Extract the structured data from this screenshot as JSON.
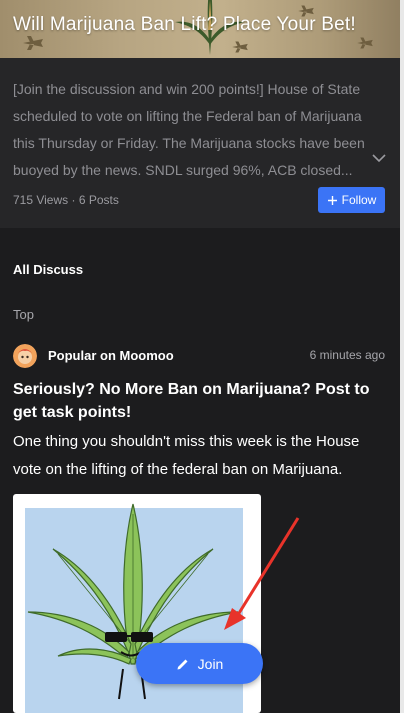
{
  "hero": {
    "title": "Will Marijuana Ban Lift?  Place Your Bet!"
  },
  "topic": {
    "description": "[Join the discussion and win 200 points!] House of State scheduled to vote on lifting the Federal ban of Marijuana this Thursday or Friday. The Marijuana stocks have been buoyed by the news. SNDL surged 96%, ACB closed...",
    "meta": "715 Views · 6 Posts",
    "follow_label": "Follow"
  },
  "feed": {
    "section_title": "All Discuss",
    "sort_label": "Top"
  },
  "post": {
    "author": "Popular on Moomoo",
    "time": "6 minutes ago",
    "title": "Seriously? No More Ban on Marijuana? Post to get task points!",
    "body": "One thing you shouldn't miss this week is the House vote on the lifting of the federal ban on Marijuana."
  },
  "join_label": "Join",
  "colors": {
    "accent": "#3b74f6",
    "background": "#1c1c1e",
    "card": "#262628",
    "annotation_arrow": "#e8332a"
  },
  "icons": {
    "expand": "chevron-down-icon",
    "follow": "plus-icon",
    "join": "pencil-icon"
  }
}
